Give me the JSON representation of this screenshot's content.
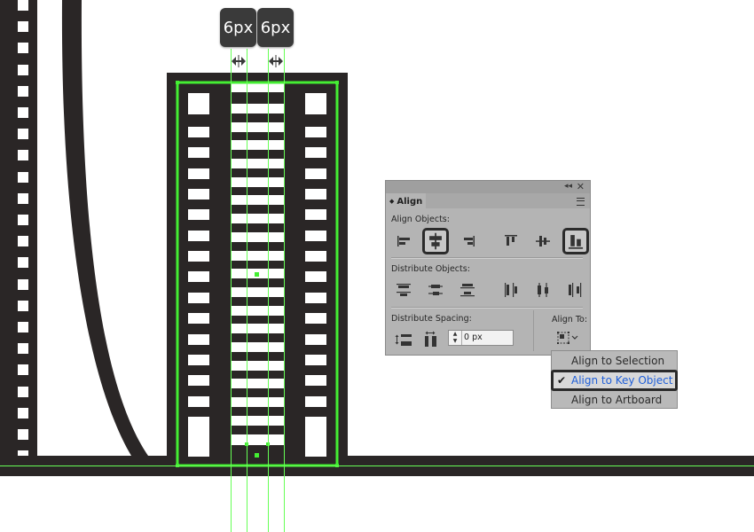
{
  "measurements": {
    "left_gap": "6px",
    "right_gap": "6px"
  },
  "align_panel": {
    "tab_label": "Align",
    "align_objects_label": "Align Objects:",
    "distribute_objects_label": "Distribute Objects:",
    "distribute_spacing_label": "Distribute Spacing:",
    "align_to_label": "Align To:",
    "spacing_value": "0 px",
    "icons": {
      "align_objects": [
        "align-left-icon",
        "align-horizontal-center-icon",
        "align-right-icon",
        "align-top-icon",
        "align-vertical-center-icon",
        "align-bottom-icon"
      ],
      "distribute_objects": [
        "distribute-top-icon",
        "distribute-vertical-center-icon",
        "distribute-bottom-icon",
        "distribute-left-icon",
        "distribute-horizontal-center-icon",
        "distribute-right-icon"
      ],
      "distribute_spacing": [
        "vertical-distribute-space-icon",
        "horizontal-distribute-space-icon"
      ]
    },
    "selected_align_objects": [
      "align-horizontal-center-icon",
      "align-bottom-icon"
    ]
  },
  "align_to_menu": {
    "items": [
      "Align to Selection",
      "Align to Key Object",
      "Align to Artboard"
    ],
    "checked": "Align to Key Object"
  },
  "colors": {
    "artwork_dark": "#2a2626",
    "guide_green": "#66ff55",
    "selection_green": "#44ee33",
    "menu_highlight_text": "#1f5fd8"
  }
}
